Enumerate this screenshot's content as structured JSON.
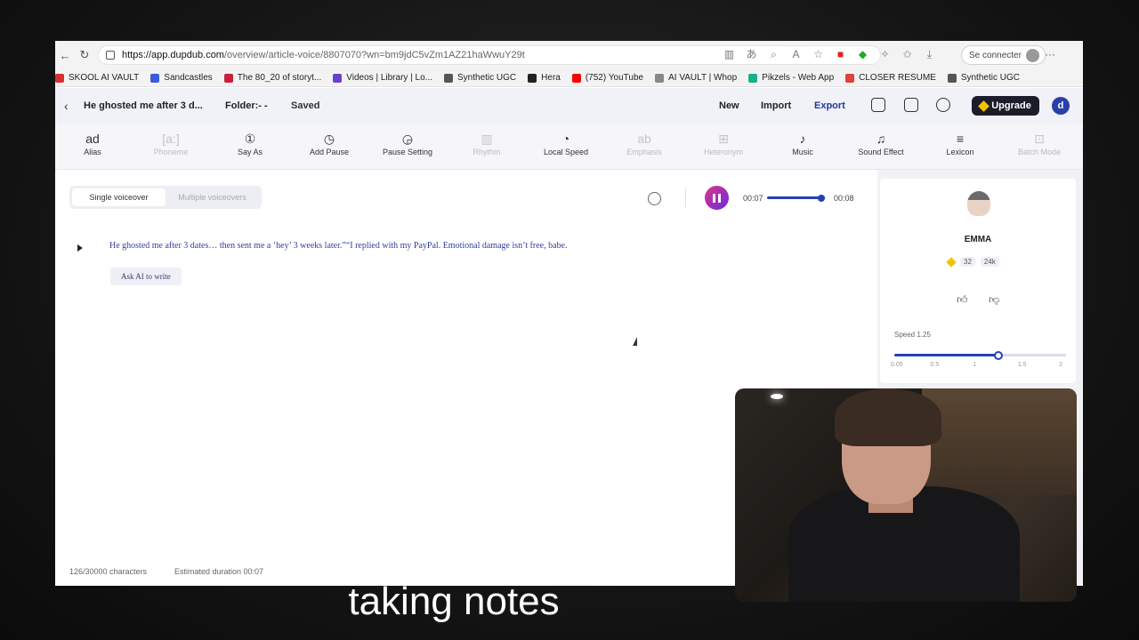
{
  "browser": {
    "url_host": "https://app.dupdub.com",
    "url_path": "/overview/article-voice/8807070?wn=bm9jdC5vZm1AZ21haWwuY29t",
    "profile_label": "Se connecter",
    "bookmarks": [
      {
        "label": "SKOOL AI VAULT",
        "color": "#d63030"
      },
      {
        "label": "Sandcastles",
        "color": "#3b5bd9"
      },
      {
        "label": "The 80_20 of storyt...",
        "color": "#c8203b"
      },
      {
        "label": "Videos | Library | Lo...",
        "color": "#6b3fd0"
      },
      {
        "label": "Synthetic UGC",
        "color": "#555555"
      },
      {
        "label": "Hera",
        "color": "#222222"
      },
      {
        "label": "(752) YouTube",
        "color": "#ff0000"
      },
      {
        "label": "AI VAULT | Whop",
        "color": "#888888"
      },
      {
        "label": "Pikzels - Web App",
        "color": "#19b08a"
      },
      {
        "label": "CLOSER RESUME",
        "color": "#e04040"
      },
      {
        "label": "Synthetic UGC",
        "color": "#555555"
      }
    ]
  },
  "header": {
    "doc_title": "He ghosted me after 3 d...",
    "folder": "Folder:- -",
    "saved": "Saved",
    "new_label": "New",
    "import_label": "Import",
    "export_label": "Export",
    "upgrade_label": "Upgrade",
    "user_initial": "d"
  },
  "toolbar": {
    "tools": [
      {
        "label": "Alias",
        "icon": "ad",
        "enabled": true
      },
      {
        "label": "Phoneme",
        "icon": "[a:]",
        "enabled": false
      },
      {
        "label": "Say As",
        "icon": "①",
        "enabled": true
      },
      {
        "label": "Add Pause",
        "icon": "◷",
        "enabled": true
      },
      {
        "label": "Pause Setting",
        "icon": "◶",
        "enabled": true
      },
      {
        "label": "Rhythm",
        "icon": "▥",
        "enabled": false
      },
      {
        "label": "Local Speed",
        "icon": "◔",
        "enabled": true
      },
      {
        "label": "Emphasis",
        "icon": "ab",
        "enabled": false
      },
      {
        "label": "Heteronym",
        "icon": "⊞",
        "enabled": false
      },
      {
        "label": "Music",
        "icon": "♪",
        "enabled": true
      },
      {
        "label": "Sound Effect",
        "icon": "♫",
        "enabled": true
      },
      {
        "label": "Lexicon",
        "icon": "≡",
        "enabled": true
      },
      {
        "label": "Batch Mode",
        "icon": "⊡",
        "enabled": false
      }
    ]
  },
  "editor": {
    "tab_single": "Single voiceover",
    "tab_multiple": "Multiple voiceovers",
    "time_current": "00:07",
    "time_duration": "00:08",
    "progress": 0.93,
    "script_text": "He ghosted me after 3 dates… then sent me a ‘hey’ 3 weeks later.”“I replied with my PayPal. Emotional damage isn’t free, babe.",
    "ask_ai": "Ask AI to write",
    "char_count": "126/30000 characters",
    "est_duration": "Estimated duration 00:07"
  },
  "voice": {
    "name": "EMMA",
    "likes": "32",
    "uses": "24k",
    "speed_label": "Speed 1.25",
    "speed_value": 1.25,
    "speed_ticks": [
      "0.05",
      "0.5",
      "1",
      "1.5",
      "2"
    ]
  },
  "subtitle": "taking notes"
}
